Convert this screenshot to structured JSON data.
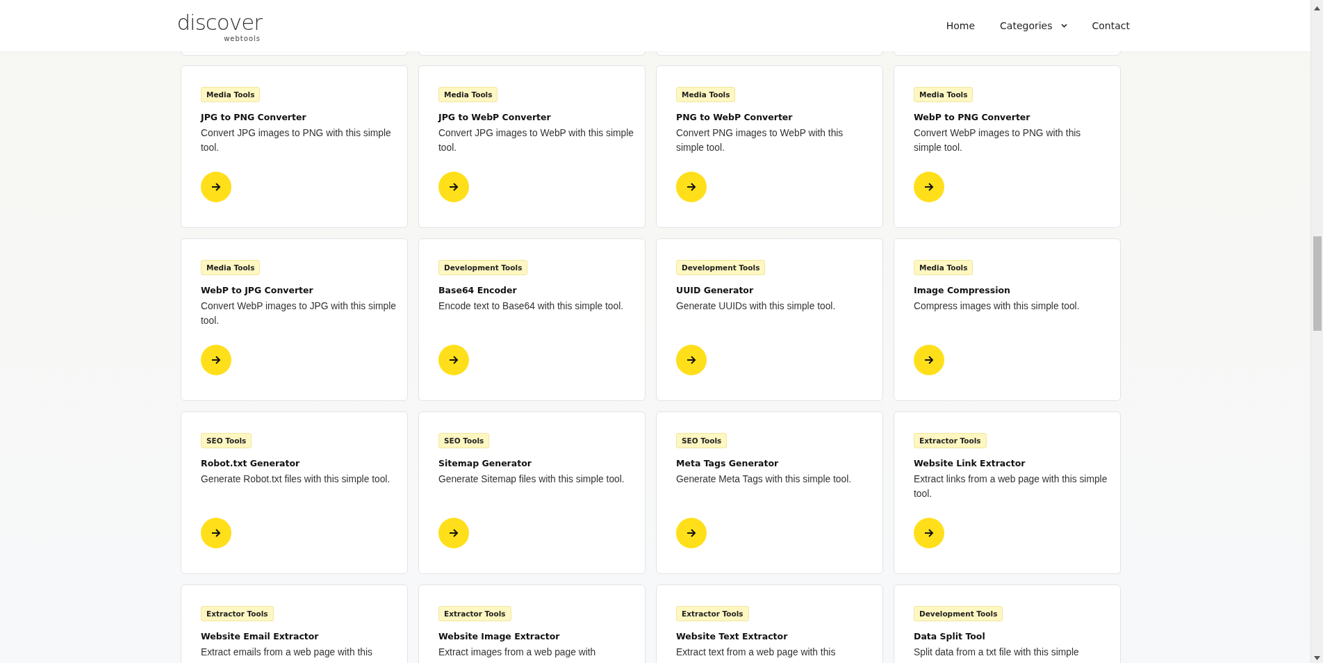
{
  "header": {
    "logo": {
      "name": "discover",
      "tagline": "webtools"
    },
    "nav": [
      {
        "label": "Home",
        "dropdown": false
      },
      {
        "label": "Categories",
        "dropdown": true
      },
      {
        "label": "Contact",
        "dropdown": false
      }
    ]
  },
  "tools": [
    {
      "category": "Media Tools",
      "title": "JPG to PNG Converter",
      "description": "Convert JPG images to PNG with this simple tool."
    },
    {
      "category": "Media Tools",
      "title": "JPG to WebP Converter",
      "description": "Convert JPG images to WebP with this simple tool."
    },
    {
      "category": "Media Tools",
      "title": "PNG to WebP Converter",
      "description": "Convert PNG images to WebP with this simple tool."
    },
    {
      "category": "Media Tools",
      "title": "WebP to PNG Converter",
      "description": "Convert WebP images to PNG with this simple tool."
    },
    {
      "category": "Media Tools",
      "title": "WebP to JPG Converter",
      "description": "Convert WebP images to JPG with this simple tool."
    },
    {
      "category": "Development Tools",
      "title": "Base64 Encoder",
      "description": "Encode text to Base64 with this simple tool."
    },
    {
      "category": "Development Tools",
      "title": "UUID Generator",
      "description": "Generate UUIDs with this simple tool."
    },
    {
      "category": "Media Tools",
      "title": "Image Compression",
      "description": "Compress images with this simple tool."
    },
    {
      "category": "SEO Tools",
      "title": "Robot.txt Generator",
      "description": "Generate Robot.txt files with this simple tool."
    },
    {
      "category": "SEO Tools",
      "title": "Sitemap Generator",
      "description": "Generate Sitemap files with this simple tool."
    },
    {
      "category": "SEO Tools",
      "title": "Meta Tags Generator",
      "description": "Generate Meta Tags with this simple tool."
    },
    {
      "category": "Extractor Tools",
      "title": "Website Link Extractor",
      "description": "Extract links from a web page with this simple tool."
    },
    {
      "category": "Extractor Tools",
      "title": "Website Email Extractor",
      "description": "Extract emails from a web page with this"
    },
    {
      "category": "Extractor Tools",
      "title": "Website Image Extractor",
      "description": "Extract images from a web page with"
    },
    {
      "category": "Extractor Tools",
      "title": "Website Text Extractor",
      "description": "Extract text from a web page with this"
    },
    {
      "category": "Development Tools",
      "title": "Data Split Tool",
      "description": "Split data from a txt file with this simple"
    }
  ]
}
